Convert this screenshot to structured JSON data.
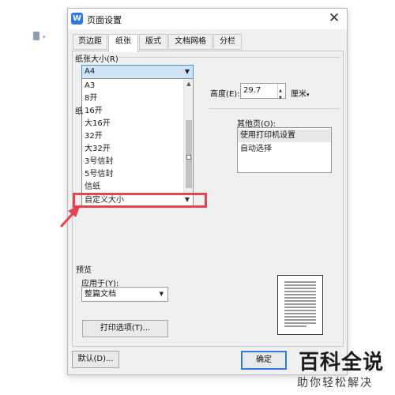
{
  "dialog": {
    "title": "页面设置",
    "app_icon": "W",
    "close_glyph": "✕"
  },
  "tabs": [
    {
      "label": "页边距",
      "active": false
    },
    {
      "label": "纸张",
      "active": true
    },
    {
      "label": "版式",
      "active": false
    },
    {
      "label": "文档网格",
      "active": false
    },
    {
      "label": "分栏",
      "active": false
    }
  ],
  "paper_size": {
    "section_label": "纸张大小(R)",
    "selected": "A4",
    "options": [
      "A3",
      "8开",
      "16开",
      "大16开",
      "32开",
      "大32开",
      "3号信封",
      "5号信封",
      "信纸",
      "自定义大小"
    ],
    "highlighted_option": "自定义大小"
  },
  "height": {
    "label": "高度(E):",
    "value": "29.7",
    "unit": "厘米"
  },
  "paper_source_fragment": "纸",
  "other_pages": {
    "label": "其他页(O):",
    "options": [
      "使用打印机设置",
      "自动选择"
    ],
    "selected": "使用打印机设置"
  },
  "preview": {
    "section_label": "预览",
    "apply_label": "应用于(Y):",
    "apply_value": "整篇文档"
  },
  "buttons": {
    "print_options": "打印选项(T)...",
    "default": "默认(D)...",
    "ok": "确定"
  },
  "icons": {
    "dropdown_arrow": "chevron-down-icon",
    "close": "close-icon",
    "red_arrow": "red-arrow-icon"
  },
  "colors": {
    "selection_blue": "#cfe4f6",
    "highlight_red": "#e8424e",
    "primary_blue": "#2f7be0"
  },
  "watermark": {
    "title": "百科全说",
    "subtitle": "助你轻松解决"
  }
}
